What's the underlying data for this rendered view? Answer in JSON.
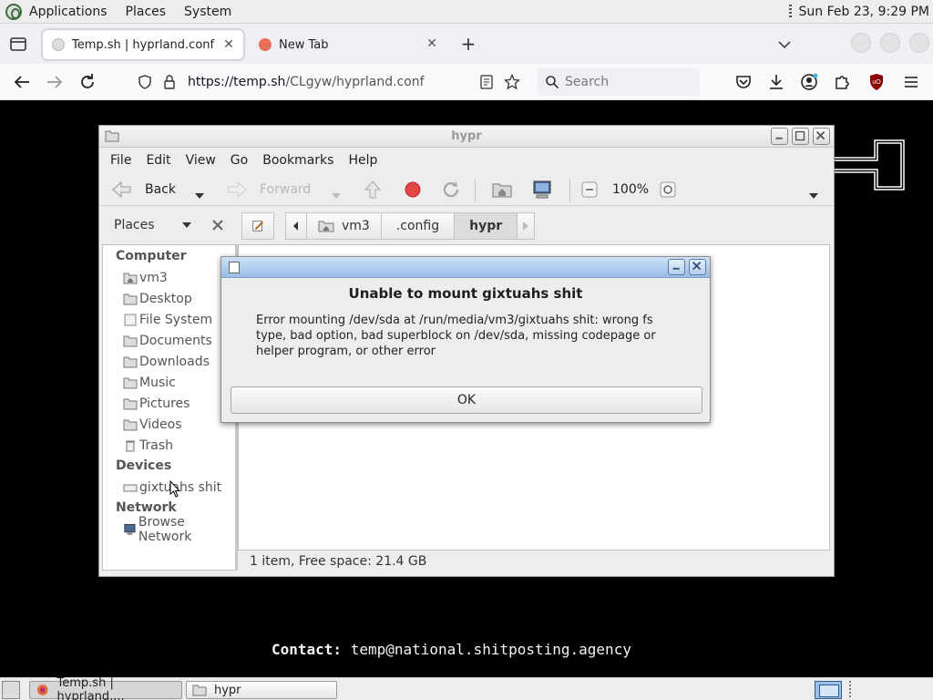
{
  "panel": {
    "menus": [
      "Applications",
      "Places",
      "System"
    ],
    "clock": "Sun Feb 23,  9:29 PM"
  },
  "browser": {
    "tabs": [
      {
        "label": "Temp.sh | hyprland.conf",
        "active": true
      },
      {
        "label": "New Tab",
        "active": false
      }
    ],
    "url_domain": "https://temp.sh",
    "url_path": "/CLgyw/hyprland.conf",
    "search_placeholder": "Search"
  },
  "page": {
    "contact_label": "Contact:",
    "contact_value": "temp@national.shitposting.agency"
  },
  "file_manager": {
    "title": "hypr",
    "menus": [
      "File",
      "Edit",
      "View",
      "Go",
      "Bookmarks",
      "Help"
    ],
    "toolbar": {
      "back": "Back",
      "forward": "Forward",
      "zoom": "100%"
    },
    "sidebar_title": "Places",
    "path": [
      "vm3",
      ".config",
      "hypr"
    ],
    "sections": {
      "computer": "Computer",
      "devices": "Devices",
      "network": "Network"
    },
    "computer_items": [
      "vm3",
      "Desktop",
      "File System",
      "Documents",
      "Downloads",
      "Music",
      "Pictures",
      "Videos",
      "Trash"
    ],
    "device_items": [
      "gixtuahs shit"
    ],
    "network_items": [
      "Browse Network"
    ],
    "status": "1 item, Free space: 21.4 GB"
  },
  "dialog": {
    "heading": "Unable to mount gixtuahs shit",
    "message": "Error mounting /dev/sda at /run/media/vm3/gixtuahs shit: wrong fs type, bad option, bad superblock on /dev/sda, missing codepage or helper program, or other error",
    "ok_label": "OK"
  },
  "taskbar": {
    "items": [
      {
        "label": "Temp.sh | hyprland....",
        "icon": "firefox-icon"
      },
      {
        "label": "hypr",
        "icon": "folder-icon"
      }
    ]
  },
  "colors": {
    "dialog_title": "#98bde8",
    "page_bg": "#000000",
    "contact_text": "#f4f4f4"
  }
}
